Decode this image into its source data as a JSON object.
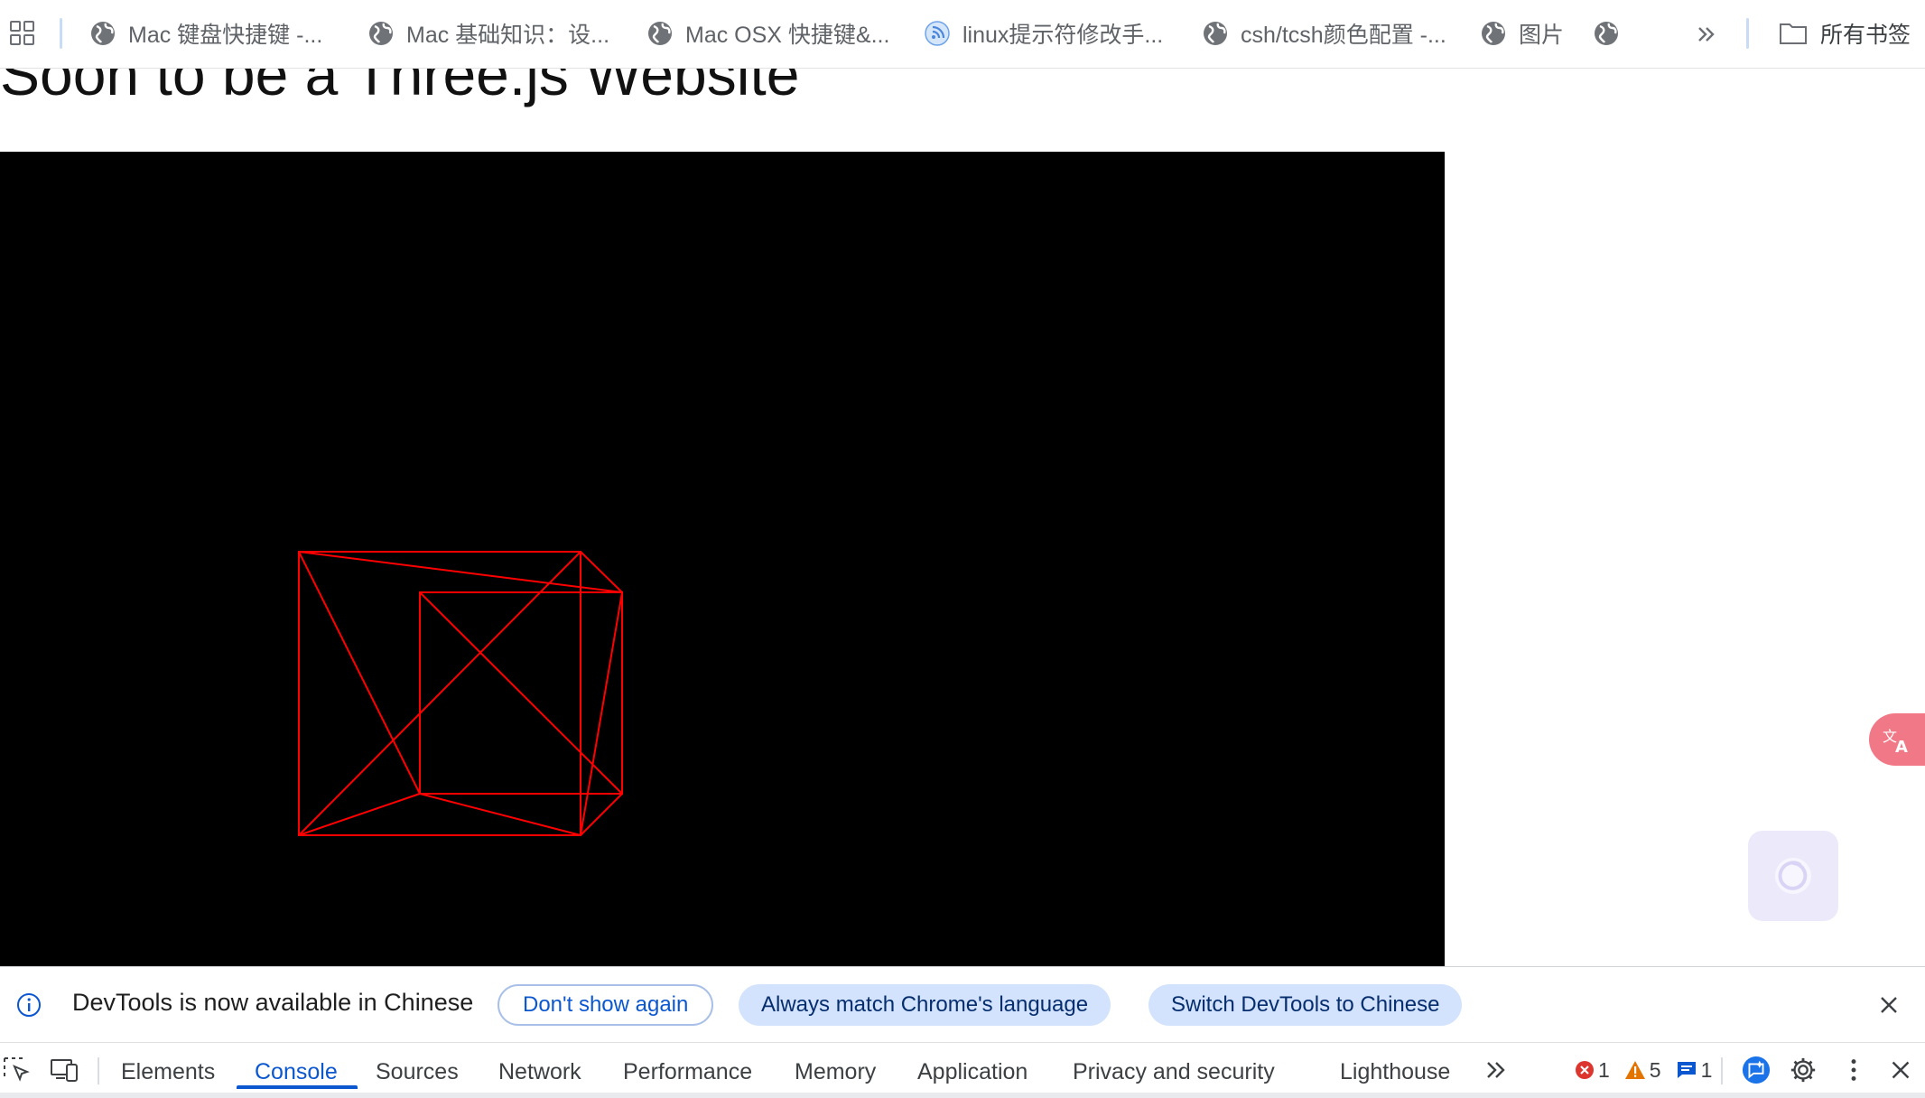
{
  "bookmarks": {
    "items": [
      {
        "label": "Mac 键盘快捷键 -..."
      },
      {
        "label": "Mac 基础知识：设..."
      },
      {
        "label": "Mac OSX 快捷键&..."
      },
      {
        "label": "linux提示符修改手..."
      },
      {
        "label": "csh/tcsh颜色配置 -..."
      },
      {
        "label": "图片"
      },
      {
        "label": ""
      }
    ],
    "all_bookmarks_label": "所有书签"
  },
  "page": {
    "heading": "Soon to be a Three.js Website",
    "wireframe_color": "#ff0000"
  },
  "devtools": {
    "infobar": {
      "message": "DevTools is now available in Chinese",
      "dont_show_label": "Don't show again",
      "always_match_label": "Always match Chrome's language",
      "switch_label": "Switch DevTools to Chinese"
    },
    "tabs": [
      {
        "label": "Elements"
      },
      {
        "label": "Console",
        "active": true
      },
      {
        "label": "Sources"
      },
      {
        "label": "Network"
      },
      {
        "label": "Performance"
      },
      {
        "label": "Memory"
      },
      {
        "label": "Application"
      },
      {
        "label": "Privacy and security"
      },
      {
        "label": "Lighthouse"
      }
    ],
    "counts": {
      "errors": "1",
      "warnings": "5",
      "messages": "1"
    },
    "accent_color": "#0b57d0"
  }
}
